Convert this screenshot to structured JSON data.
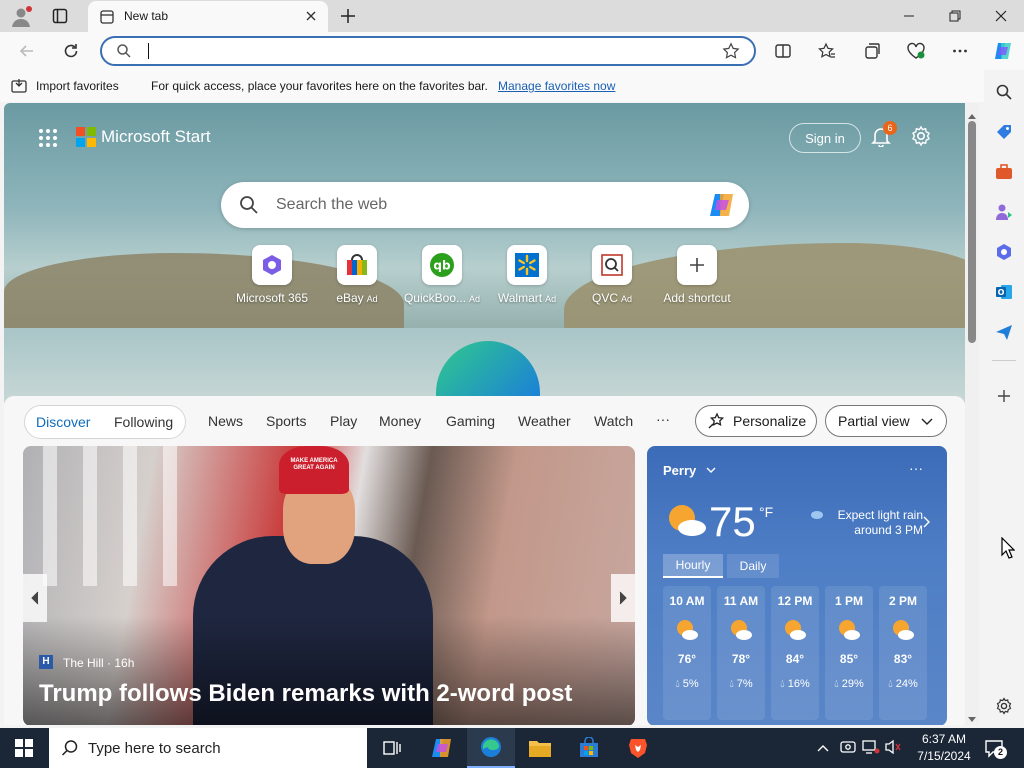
{
  "browser": {
    "tab_title": "New tab",
    "address_value": "",
    "colors": {
      "accent": "#3a6fb3",
      "titlebar": "#dcdcdc"
    }
  },
  "favorites_bar": {
    "import_label": "Import favorites",
    "message": "For quick access, place your favorites here on the favorites bar.",
    "manage_link": "Manage favorites now"
  },
  "start": {
    "brand": "Microsoft Start",
    "sign_in": "Sign in",
    "notification_count": "6",
    "search_placeholder": "Search the web",
    "shortcuts": [
      {
        "label": "Microsoft 365",
        "ad": "",
        "icon": "m365-icon"
      },
      {
        "label": "eBay",
        "ad": "Ad",
        "icon": "ebay-icon"
      },
      {
        "label": "QuickBoo...",
        "ad": "Ad",
        "icon": "quickbooks-icon"
      },
      {
        "label": "Walmart",
        "ad": "Ad",
        "icon": "walmart-icon"
      },
      {
        "label": "QVC",
        "ad": "Ad",
        "icon": "qvc-icon"
      },
      {
        "label": "Add shortcut",
        "ad": "",
        "icon": "plus-icon"
      }
    ]
  },
  "feed_nav": {
    "discover": "Discover",
    "following": "Following",
    "items": [
      "News",
      "Sports",
      "Play",
      "Money",
      "Gaming",
      "Weather",
      "Watch"
    ],
    "more": "···",
    "personalize": "Personalize",
    "partial_view": "Partial view"
  },
  "news": {
    "source": "The Hill · 16h",
    "headline": "Trump follows Biden remarks with 2-word post",
    "hat_text": "MAKE AMERICA GREAT AGAIN"
  },
  "weather": {
    "location": "Perry",
    "temp": "75",
    "unit": "°F",
    "alert": "Expect light rain around 3 PM",
    "tab_hourly": "Hourly",
    "tab_daily": "Daily",
    "hours": [
      {
        "time": "10 AM",
        "temp": "76°",
        "precip": "5%"
      },
      {
        "time": "11 AM",
        "temp": "78°",
        "precip": "7%"
      },
      {
        "time": "12 PM",
        "temp": "84°",
        "precip": "16%"
      },
      {
        "time": "1 PM",
        "temp": "85°",
        "precip": "29%"
      },
      {
        "time": "2 PM",
        "temp": "83°",
        "precip": "24%"
      }
    ]
  },
  "taskbar": {
    "search_placeholder": "Type here to search",
    "time": "6:37 AM",
    "date": "7/15/2024",
    "notification_count": "2"
  }
}
